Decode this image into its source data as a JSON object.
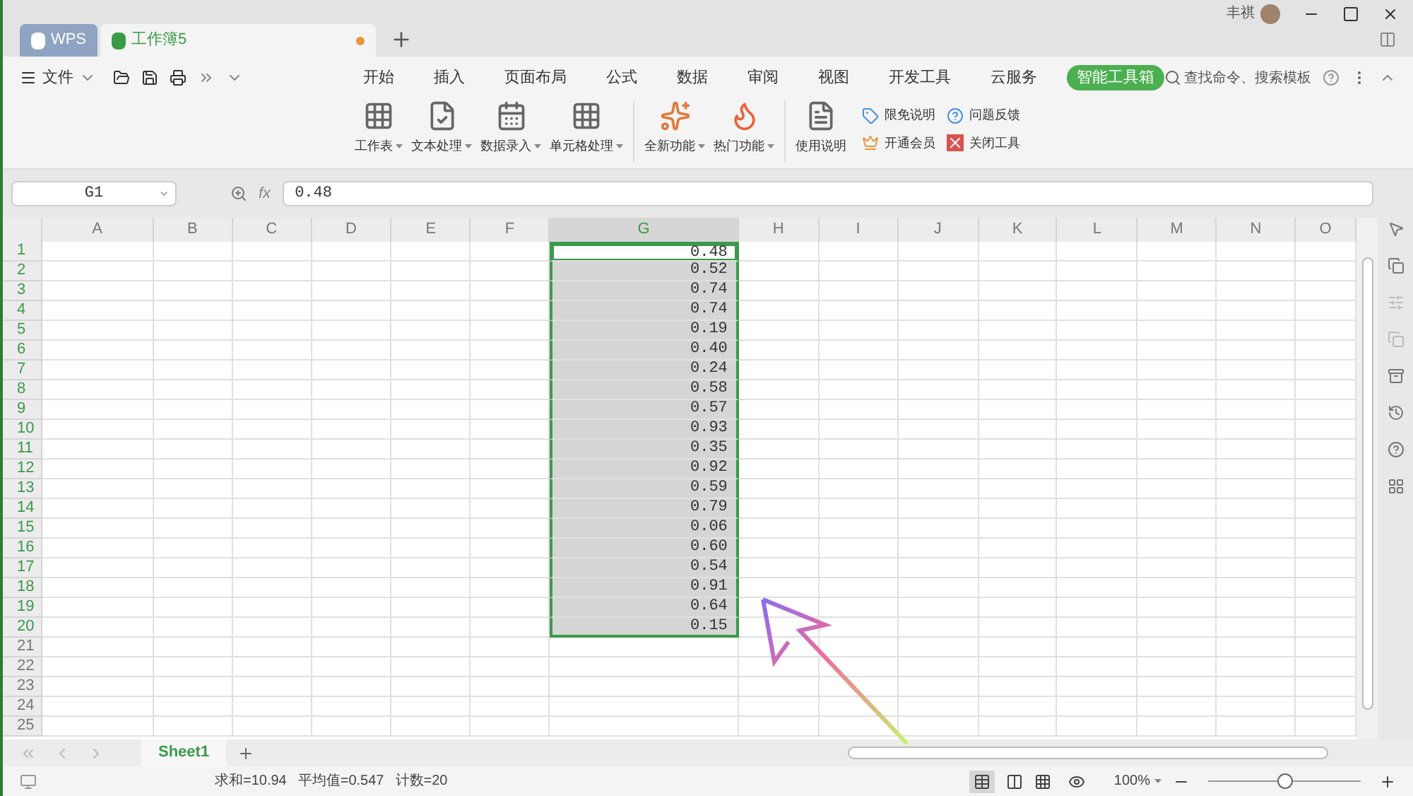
{
  "title_bar": {
    "tabs": [
      {
        "kind": "home",
        "label": "WPS",
        "selected": false
      },
      {
        "kind": "doc",
        "label": "工作簿5",
        "selected": true,
        "unsaved": true
      }
    ],
    "user": "丰祺"
  },
  "menu": {
    "file": "文件",
    "tabs": [
      {
        "label": "开始",
        "selected": false
      },
      {
        "label": "插入",
        "selected": false
      },
      {
        "label": "页面布局",
        "selected": false
      },
      {
        "label": "公式",
        "selected": false
      },
      {
        "label": "数据",
        "selected": false
      },
      {
        "label": "审阅",
        "selected": false
      },
      {
        "label": "视图",
        "selected": false
      },
      {
        "label": "开发工具",
        "selected": false
      },
      {
        "label": "云服务",
        "selected": false
      },
      {
        "label": "智能工具箱",
        "selected": true
      }
    ],
    "search": "查找命令、搜索模板"
  },
  "ribbon": {
    "big_buttons": [
      {
        "kind": "sheet",
        "label": "工作表"
      },
      {
        "kind": "text",
        "label": "文本处理"
      },
      {
        "kind": "entry",
        "label": "数据录入"
      },
      {
        "kind": "cell",
        "label": "单元格处理"
      },
      {
        "kind": "new",
        "label": "全新功能"
      },
      {
        "kind": "hot",
        "label": "热门功能"
      },
      {
        "kind": "doc",
        "label": "使用说明"
      }
    ],
    "small_buttons": [
      {
        "kind": "tag",
        "label": "限免说明"
      },
      {
        "kind": "help",
        "label": "问题反馈"
      },
      {
        "kind": "crown",
        "label": "开通会员"
      },
      {
        "kind": "close",
        "label": "关闭工具"
      }
    ]
  },
  "formula_bar": {
    "name_box": "G1",
    "fx_label": "fx",
    "formula": "0.48"
  },
  "columns": [
    {
      "label": "A",
      "selected": false
    },
    {
      "label": "B",
      "selected": false
    },
    {
      "label": "C",
      "selected": false
    },
    {
      "label": "D",
      "selected": false
    },
    {
      "label": "E",
      "selected": false
    },
    {
      "label": "F",
      "selected": false
    },
    {
      "label": "G",
      "selected": true
    },
    {
      "label": "H",
      "selected": false
    },
    {
      "label": "I",
      "selected": false
    },
    {
      "label": "J",
      "selected": false
    },
    {
      "label": "K",
      "selected": false
    },
    {
      "label": "L",
      "selected": false
    },
    {
      "label": "M",
      "selected": false
    },
    {
      "label": "N",
      "selected": false
    },
    {
      "label": "O",
      "selected": false
    }
  ],
  "rows": [
    {
      "number": "1",
      "selected": true,
      "active": true,
      "g": "0.48"
    },
    {
      "number": "2",
      "selected": true,
      "active": false,
      "g": "0.52"
    },
    {
      "number": "3",
      "selected": true,
      "active": false,
      "g": "0.74"
    },
    {
      "number": "4",
      "selected": true,
      "active": false,
      "g": "0.74"
    },
    {
      "number": "5",
      "selected": true,
      "active": false,
      "g": "0.19"
    },
    {
      "number": "6",
      "selected": true,
      "active": false,
      "g": "0.40"
    },
    {
      "number": "7",
      "selected": true,
      "active": false,
      "g": "0.24"
    },
    {
      "number": "8",
      "selected": true,
      "active": false,
      "g": "0.58"
    },
    {
      "number": "9",
      "selected": true,
      "active": false,
      "g": "0.57"
    },
    {
      "number": "10",
      "selected": true,
      "active": false,
      "g": "0.93"
    },
    {
      "number": "11",
      "selected": true,
      "active": false,
      "g": "0.35"
    },
    {
      "number": "12",
      "selected": true,
      "active": false,
      "g": "0.92"
    },
    {
      "number": "13",
      "selected": true,
      "active": false,
      "g": "0.59"
    },
    {
      "number": "14",
      "selected": true,
      "active": false,
      "g": "0.79"
    },
    {
      "number": "15",
      "selected": true,
      "active": false,
      "g": "0.06"
    },
    {
      "number": "16",
      "selected": true,
      "active": false,
      "g": "0.60"
    },
    {
      "number": "17",
      "selected": true,
      "active": false,
      "g": "0.54"
    },
    {
      "number": "18",
      "selected": true,
      "active": false,
      "g": "0.91"
    },
    {
      "number": "19",
      "selected": true,
      "active": false,
      "g": "0.64"
    },
    {
      "number": "20",
      "selected": true,
      "active": false,
      "g": "0.15"
    },
    {
      "number": "21",
      "selected": false,
      "active": false
    },
    {
      "number": "22",
      "selected": false,
      "active": false
    },
    {
      "number": "23",
      "selected": false,
      "active": false
    },
    {
      "number": "24",
      "selected": false,
      "active": false
    },
    {
      "number": "25",
      "selected": false,
      "active": false
    }
  ],
  "sheets": [
    {
      "label": "Sheet1",
      "selected": true
    }
  ],
  "status_bar": {
    "stats": [
      "求和=10.94",
      "平均值=0.547",
      "计数=20"
    ],
    "zoom": "100%",
    "zoom_slider": {
      "level": 0.5
    }
  }
}
